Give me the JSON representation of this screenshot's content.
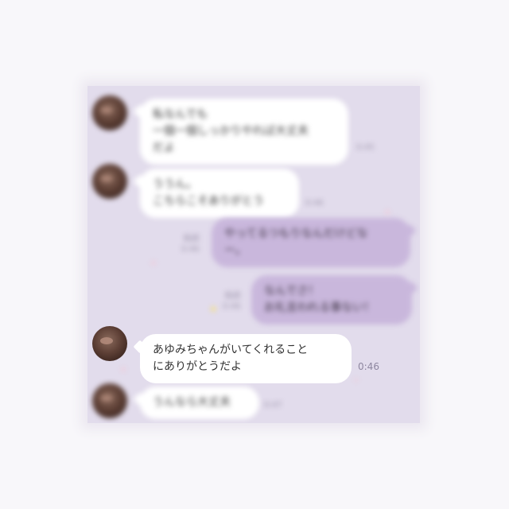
{
  "messages": [
    {
      "side": "in",
      "text": "私なんでも\n一個一個しっかりやれば大丈夫\nだよ",
      "time": "0:45"
    },
    {
      "side": "in",
      "text": "ううん。\nこちらこそありがとう",
      "time": "0:46"
    },
    {
      "side": "out",
      "text": "やってるつもりなんだけどな\nー。",
      "read": "既読",
      "time": "0:46"
    },
    {
      "side": "out",
      "text": "なんでさ！\nお礼言われる事ない！",
      "read": "既読",
      "time": "0:46"
    },
    {
      "side": "in",
      "text": "あゆみちゃんがいてくれること\nにありがとうだよ",
      "time": "0:46"
    },
    {
      "side": "in",
      "text": "うんなら大丈夫",
      "time": "0:47"
    }
  ],
  "colors": {
    "panel": "#e2dcec",
    "incoming": "#ffffff",
    "outgoing": "#c9b7dc"
  }
}
